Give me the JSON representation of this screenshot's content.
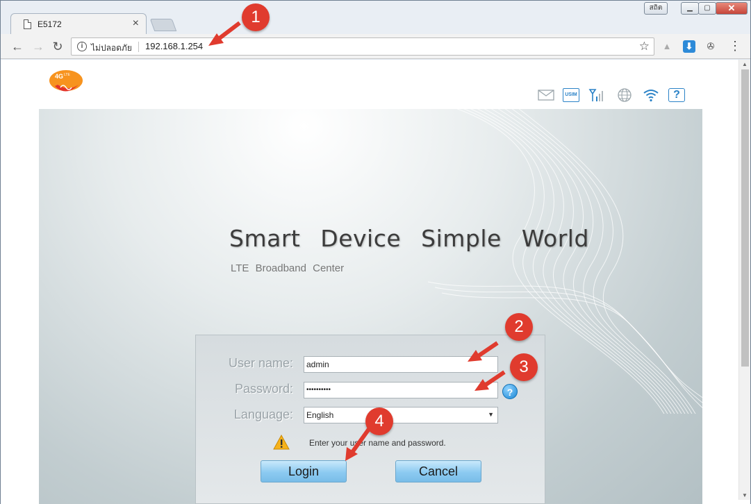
{
  "browser": {
    "tab_title": "E5172",
    "tab_close": "×",
    "user_badge": "สถิต",
    "minimize": "▁",
    "maximize": "▢",
    "close": "✕",
    "back": "←",
    "forward": "→",
    "reload": "↻",
    "security_label": "ไม่ปลอดภัย",
    "url": "192.168.1.254",
    "star": "☆",
    "menu": "⋮"
  },
  "header": {
    "logo_text": "4G LTE",
    "status_icons": [
      "mail-icon",
      "usim-icon",
      "signal-icon",
      "globe-icon",
      "wifi-icon",
      "help-icon"
    ],
    "usim_text": "USIM",
    "help_text": "?"
  },
  "hero": {
    "slogan": "Smart Device Simple World",
    "subtitle": "LTE Broadband Center"
  },
  "login": {
    "username_label": "User name:",
    "username_value": "admin",
    "password_label": "Password:",
    "password_value": "••••••••••",
    "language_label": "Language:",
    "language_value": "English",
    "help_glyph": "?",
    "hint": "Enter your user name and password.",
    "login_button": "Login",
    "cancel_button": "Cancel"
  },
  "annotations": [
    "1",
    "2",
    "3",
    "4"
  ],
  "colors": {
    "annotation_red": "#e03b2e",
    "button_blue": "#8ccaf1",
    "logo_orange": "#f7931e"
  }
}
